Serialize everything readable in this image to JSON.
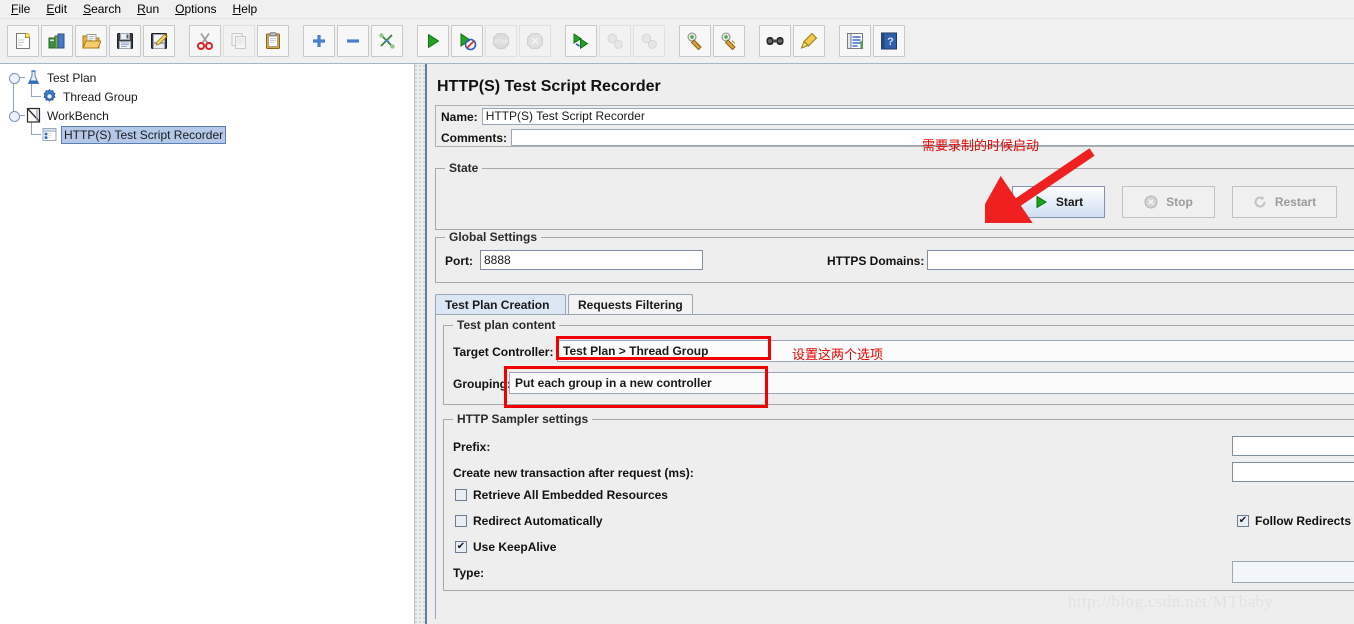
{
  "menu": {
    "items": [
      {
        "label": "File",
        "mnemonic": "F"
      },
      {
        "label": "Edit",
        "mnemonic": "E"
      },
      {
        "label": "Search",
        "mnemonic": "S"
      },
      {
        "label": "Run",
        "mnemonic": "R"
      },
      {
        "label": "Options",
        "mnemonic": "O"
      },
      {
        "label": "Help",
        "mnemonic": "H"
      }
    ]
  },
  "toolbar": {
    "buttons": [
      {
        "name": "new-icon",
        "title": "New",
        "enabled": true
      },
      {
        "name": "templates-icon",
        "title": "Templates",
        "enabled": true
      },
      {
        "name": "open-icon",
        "title": "Open",
        "enabled": true
      },
      {
        "name": "save-icon",
        "title": "Save Test Plan",
        "enabled": true
      },
      {
        "name": "save-as-icon",
        "title": "Save Test Plan as",
        "enabled": true
      },
      {
        "name": "cut-icon",
        "title": "Cut",
        "enabled": true
      },
      {
        "name": "copy-icon",
        "title": "Copy",
        "enabled": false
      },
      {
        "name": "paste-icon",
        "title": "Paste",
        "enabled": true
      },
      {
        "name": "expand-all-icon",
        "title": "Expand All",
        "enabled": true
      },
      {
        "name": "collapse-all-icon",
        "title": "Collapse All",
        "enabled": true
      },
      {
        "name": "toggle-icon",
        "title": "Toggle",
        "enabled": true
      },
      {
        "name": "start-icon",
        "title": "Start",
        "enabled": true
      },
      {
        "name": "start-no-pause-icon",
        "title": "Start no pauses",
        "enabled": true
      },
      {
        "name": "stop-icon",
        "title": "Stop",
        "enabled": false
      },
      {
        "name": "shutdown-icon",
        "title": "Shutdown",
        "enabled": false
      },
      {
        "name": "remote-start-all-icon",
        "title": "Remote Start All",
        "enabled": true
      },
      {
        "name": "remote-stop-all-icon",
        "title": "Remote Stop All",
        "enabled": false
      },
      {
        "name": "remote-shutdown-all-icon",
        "title": "Remote Shutdown All",
        "enabled": false
      },
      {
        "name": "clear-icon",
        "title": "Clear",
        "enabled": true
      },
      {
        "name": "clear-all-icon",
        "title": "Clear All",
        "enabled": true
      },
      {
        "name": "search-icon",
        "title": "Search",
        "enabled": true
      },
      {
        "name": "search-reset-icon",
        "title": "Reset Search",
        "enabled": true
      },
      {
        "name": "function-helper-icon",
        "title": "Function Helper Dialog",
        "enabled": true
      },
      {
        "name": "help-icon",
        "title": "Help",
        "enabled": true
      }
    ]
  },
  "tree": {
    "nodes": [
      {
        "label": "Test Plan",
        "icon": "test-plan-icon",
        "depth": 0,
        "expanded": true,
        "selected": false
      },
      {
        "label": "Thread Group",
        "icon": "thread-group-icon",
        "depth": 1,
        "expanded": false,
        "selected": false
      },
      {
        "label": "WorkBench",
        "icon": "workbench-icon",
        "depth": 0,
        "expanded": true,
        "selected": false
      },
      {
        "label": "HTTP(S) Test Script Recorder",
        "icon": "recorder-icon",
        "depth": 1,
        "expanded": false,
        "selected": true
      }
    ]
  },
  "main": {
    "title": "HTTP(S) Test Script Recorder",
    "name_label": "Name:",
    "name_value": "HTTP(S) Test Script Recorder",
    "comments_label": "Comments:",
    "comments_value": "",
    "state": {
      "legend": "State",
      "start_label": "Start",
      "stop_label": "Stop",
      "restart_label": "Restart"
    },
    "global_settings": {
      "legend": "Global Settings",
      "port_label": "Port:",
      "port_value": "8888",
      "https_domains_label": "HTTPS Domains:",
      "https_domains_value": ""
    },
    "tabs": [
      {
        "label": "Test Plan Creation",
        "active": true
      },
      {
        "label": "Requests Filtering",
        "active": false
      }
    ],
    "test_plan_content": {
      "legend": "Test plan content",
      "target_controller_label": "Target Controller:",
      "target_controller_value": "Test Plan > Thread Group",
      "grouping_label": "Grouping:",
      "grouping_value": "Put each group in a new controller"
    },
    "http_sampler_settings": {
      "legend": "HTTP Sampler settings",
      "prefix_label": "Prefix:",
      "prefix_value": "",
      "transaction_label": "Create new transaction after request (ms):",
      "transaction_value": "",
      "retrieve_embedded_label": "Retrieve All Embedded Resources",
      "retrieve_embedded_checked": false,
      "redirect_auto_label": "Redirect Automatically",
      "redirect_auto_checked": false,
      "follow_redirects_label": "Follow Redirects",
      "follow_redirects_checked": true,
      "keepalive_label": "Use KeepAlive",
      "keepalive_checked": true,
      "type_label": "Type:",
      "type_value": ""
    }
  },
  "annotations": {
    "start_note": "需要录制的时候启动",
    "options_note": "设置这两个选项",
    "color": "#f00000"
  },
  "watermark": "http://blog.csdn.net/MTbaby"
}
